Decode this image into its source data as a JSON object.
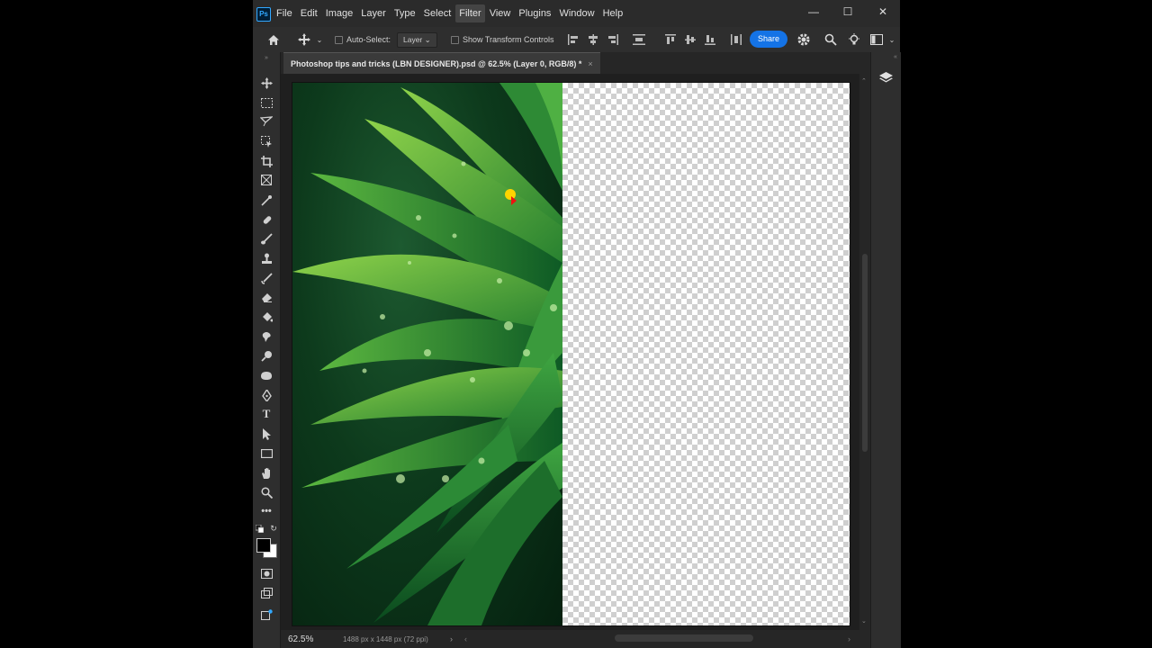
{
  "app": {
    "logo_text": "Ps"
  },
  "menu": [
    "File",
    "Edit",
    "Image",
    "Layer",
    "Type",
    "Select",
    "Filter",
    "View",
    "Plugins",
    "Window",
    "Help"
  ],
  "window_controls": {
    "minimize": "—",
    "maximize": "☐",
    "close": "✕"
  },
  "options_bar": {
    "auto_select_label": "Auto-Select:",
    "layer_select_value": "Layer",
    "show_transform_label": "Show Transform Controls",
    "share_label": "Share"
  },
  "document_tab": {
    "title": "Photoshop tips and tricks (LBN DESIGNER).psd @ 62.5% (Layer 0, RGB/8) *",
    "close": "×"
  },
  "status_bar": {
    "zoom": "62.5%",
    "doc_info": "1488 px x 1448 px (72 ppi)",
    "arrow": "›"
  },
  "colors": {
    "accent": "#1473e6",
    "foreground": "#000000",
    "background": "#ffffff"
  },
  "tools": [
    "move-tool-icon",
    "marquee-tool-icon",
    "lasso-tool-icon",
    "object-select-tool-icon",
    "crop-tool-icon",
    "frame-tool-icon",
    "eyedropper-tool-icon",
    "healing-brush-icon",
    "brush-tool-icon",
    "clone-stamp-icon",
    "history-brush-icon",
    "eraser-tool-icon",
    "paint-bucket-icon",
    "smudge-tool-icon",
    "dodge-tool-icon",
    "sponge-tool-icon",
    "pen-tool-icon",
    "type-tool-icon",
    "path-select-icon",
    "rectangle-tool-icon",
    "hand-tool-icon",
    "zoom-tool-icon",
    "more-tools-icon"
  ]
}
